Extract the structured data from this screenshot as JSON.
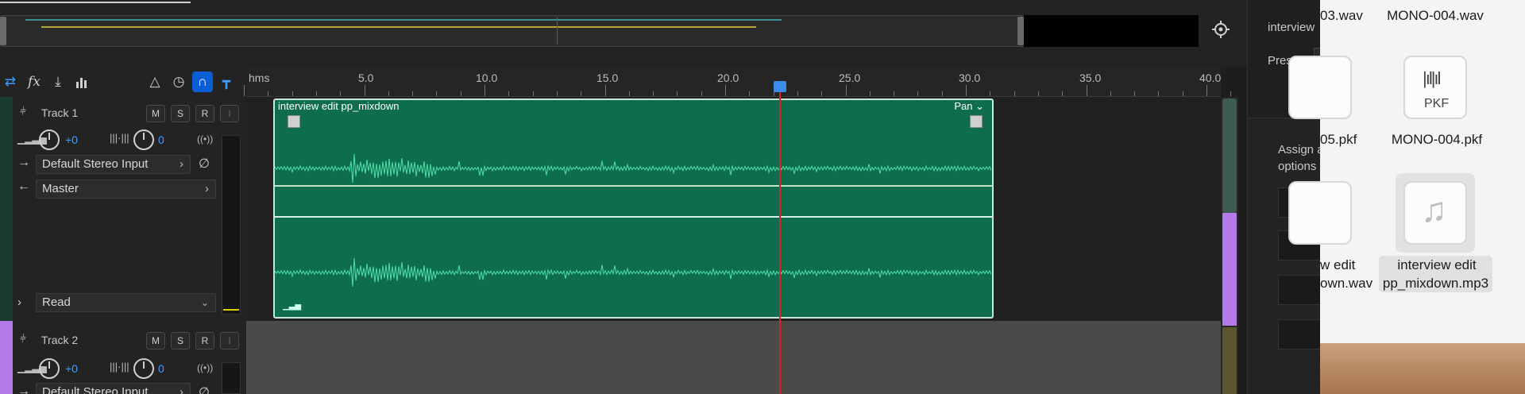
{
  "overview": {
    "zoom_icon": "zoom-icon"
  },
  "toolbar": {
    "icons": [
      "loop-icon",
      "fx-icon",
      "merge-icon",
      "meter-icon",
      "metronome-icon",
      "snap-stopwatch-icon",
      "magnet-icon",
      "marker-icon"
    ]
  },
  "ruler": {
    "unit": "hms",
    "ticks": [
      "5.0",
      "10.0",
      "15.0",
      "20.0",
      "25.0",
      "30.0",
      "35.0",
      "40.0"
    ]
  },
  "tracks": [
    {
      "name": "Track 1",
      "volume": "+0",
      "pan": "0",
      "input": "Default Stereo Input",
      "output": "Master",
      "automation": "Read",
      "buttons": [
        "M",
        "S",
        "R",
        "I"
      ],
      "color": "#0f6d4f"
    },
    {
      "name": "Track 2",
      "volume": "+0",
      "pan": "0",
      "input": "Default Stereo Input",
      "buttons": [
        "M",
        "S",
        "R",
        "I"
      ],
      "color": "#b57ae8"
    }
  ],
  "clip": {
    "title": "interview edit pp_mixdown",
    "pan_label": "Pan"
  },
  "right_panel": {
    "title": "interview",
    "preset_label": "Preset:",
    "assign_label": "Assign a",
    "options_label": "options"
  },
  "finder": {
    "files": [
      {
        "name": "03.wav",
        "kind": "wav"
      },
      {
        "name": "MONO-004.wav",
        "kind": "wav"
      },
      {
        "name": "05.pkf",
        "kind": "pkf"
      },
      {
        "name": "MONO-004.pkf",
        "kind": "pkf",
        "badge": "PKF"
      },
      {
        "name_line1": "w edit",
        "name_line2": "own.wav",
        "kind": "wav"
      },
      {
        "name_line1": "interview edit",
        "name_line2": "pp_mixdown.mp3",
        "kind": "mp3"
      }
    ]
  }
}
